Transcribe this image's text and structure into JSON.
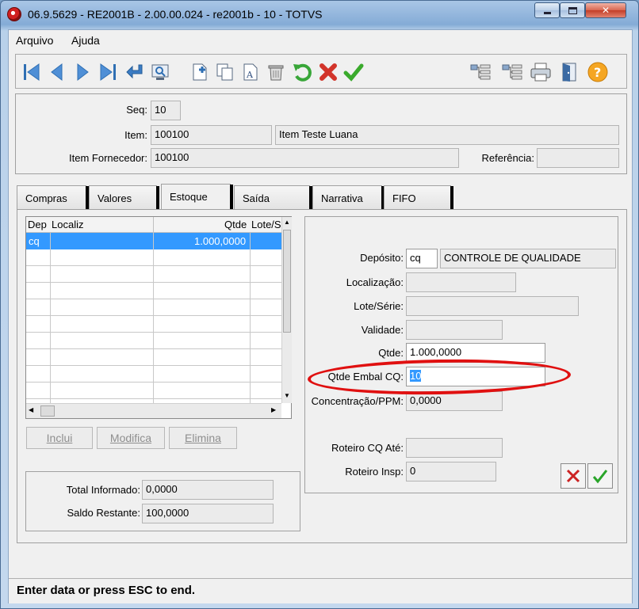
{
  "window": {
    "title": "06.9.5629 - RE2001B - 2.00.00.024 - re2001b - 10 - TOTVS"
  },
  "menu": {
    "items": [
      "Arquivo",
      "Ajuda"
    ]
  },
  "header": {
    "seq_label": "Seq:",
    "seq_value": "10",
    "item_label": "Item:",
    "item_code": "100100",
    "item_desc": "Item Teste Luana",
    "fornecedor_label": "Item Fornecedor:",
    "fornecedor_value": "100100",
    "referencia_label": "Referência:",
    "referencia_value": ""
  },
  "tabs": [
    "Compras",
    "Valores",
    "Estoque",
    "Saída",
    "Narrativa",
    "FIFO"
  ],
  "active_tab": "Estoque",
  "grid": {
    "columns": [
      "Dep",
      "Localiz",
      "Qtde",
      "Lote/S"
    ],
    "rows": [
      {
        "dep": "cq",
        "localiz": "",
        "qtde": "1.000,0000",
        "lote": ""
      }
    ]
  },
  "grid_buttons": {
    "inclui": "Inclui",
    "modifica": "Modifica",
    "elimina": "Elimina"
  },
  "totals": {
    "total_label": "Total Informado:",
    "total_value": "0,0000",
    "saldo_label": "Saldo Restante:",
    "saldo_value": "100,0000"
  },
  "detail": {
    "deposito_label": "Depósito:",
    "deposito_code": "cq",
    "deposito_desc": "CONTROLE DE QUALIDADE",
    "localizacao_label": "Localização:",
    "localizacao_value": "",
    "lote_label": "Lote/Série:",
    "lote_value": "",
    "validade_label": "Validade:",
    "validade_value": "",
    "qtde_label": "Qtde:",
    "qtde_value": "1.000,0000",
    "embal_label": "Qtde Embal CQ:",
    "embal_value": "10",
    "concentracao_label": "Concentração/PPM:",
    "concentracao_value": "0,0000",
    "roteiro_cq_label": "Roteiro CQ Até:",
    "roteiro_cq_value": "",
    "roteiro_insp_label": "Roteiro Insp:",
    "roteiro_insp_value": "0"
  },
  "status": {
    "text": "Enter data or press ESC to end."
  },
  "colors": {
    "highlight": "#3399ff",
    "annotation": "#e01010",
    "cancel": "#cc2222",
    "confirm": "#2aa52a"
  }
}
